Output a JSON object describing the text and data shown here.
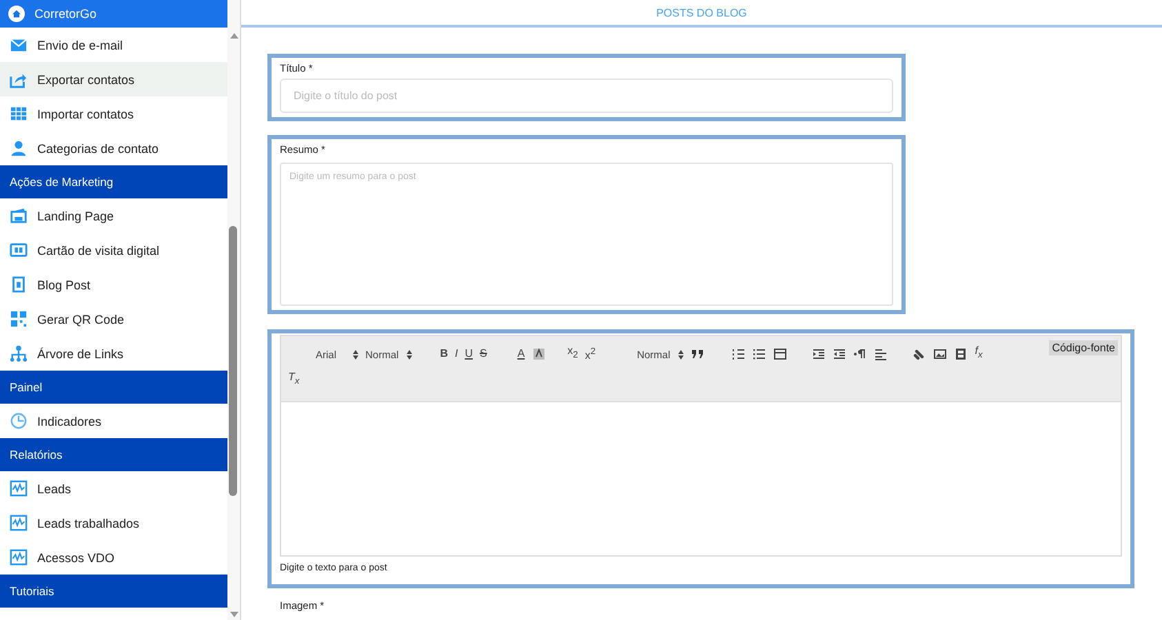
{
  "sidebar": {
    "app_name": "CorretorGo",
    "items": [
      {
        "kind": "item",
        "label": "Envio de e-mail",
        "selected": false
      },
      {
        "kind": "item",
        "label": "Exportar contatos",
        "selected": true
      },
      {
        "kind": "item",
        "label": "Importar contatos",
        "selected": false
      },
      {
        "kind": "item",
        "label": "Categorias de contato",
        "selected": false
      },
      {
        "kind": "section",
        "label": "Ações de Marketing"
      },
      {
        "kind": "item",
        "label": "Landing Page",
        "selected": false
      },
      {
        "kind": "item",
        "label": "Cartão de visita digital",
        "selected": false
      },
      {
        "kind": "item",
        "label": "Blog Post",
        "selected": false
      },
      {
        "kind": "item",
        "label": "Gerar QR Code",
        "selected": false
      },
      {
        "kind": "item",
        "label": "Árvore de Links",
        "selected": false
      },
      {
        "kind": "section",
        "label": "Painel"
      },
      {
        "kind": "item",
        "label": "Indicadores",
        "selected": false
      },
      {
        "kind": "section",
        "label": "Relatórios"
      },
      {
        "kind": "item",
        "label": "Leads",
        "selected": false
      },
      {
        "kind": "item",
        "label": "Leads trabalhados",
        "selected": false
      },
      {
        "kind": "item",
        "label": "Acessos VDO",
        "selected": false
      },
      {
        "kind": "section",
        "label": "Tutoriais"
      }
    ]
  },
  "page_title": "POSTS DO BLOG",
  "title_field": {
    "label": "Título *",
    "placeholder": "Digite o título do post"
  },
  "summary_field": {
    "label": "Resumo *",
    "placeholder": "Digite um resumo para o post"
  },
  "editor": {
    "toolbar": [
      {
        "kind": "picker",
        "label": "Arial"
      },
      {
        "kind": "picker",
        "label": "Normal"
      },
      {
        "kind": "glyph",
        "label": "B"
      },
      {
        "kind": "glyph",
        "label": "I"
      },
      {
        "kind": "glyph",
        "label": "U"
      },
      {
        "kind": "glyph",
        "label": "S"
      },
      {
        "kind": "glyph",
        "label": "A"
      },
      {
        "kind": "icon"
      },
      {
        "kind": "glyph",
        "label": "x$_{2}$"
      },
      {
        "kind": "glyph",
        "label": "x$^{2}$"
      },
      {
        "kind": "picker",
        "label": "Normal"
      },
      {
        "kind": "icon"
      },
      {
        "kind": "icon"
      },
      {
        "kind": "icon"
      },
      {
        "kind": "icon"
      },
      {
        "kind": "icon"
      },
      {
        "kind": "icon"
      },
      {
        "kind": "icon"
      },
      {
        "kind": "icon"
      },
      {
        "kind": "icon"
      },
      {
        "kind": "icon"
      },
      {
        "kind": "icon"
      },
      {
        "kind": "glyph",
        "label": "f$_{x}$"
      },
      {
        "kind": "glyph",
        "label": "T$_{x}$"
      }
    ],
    "source_button": "Código-fonte",
    "helper": "Digite o texto para o post"
  },
  "image_field": {
    "label": "Imagem *"
  }
}
